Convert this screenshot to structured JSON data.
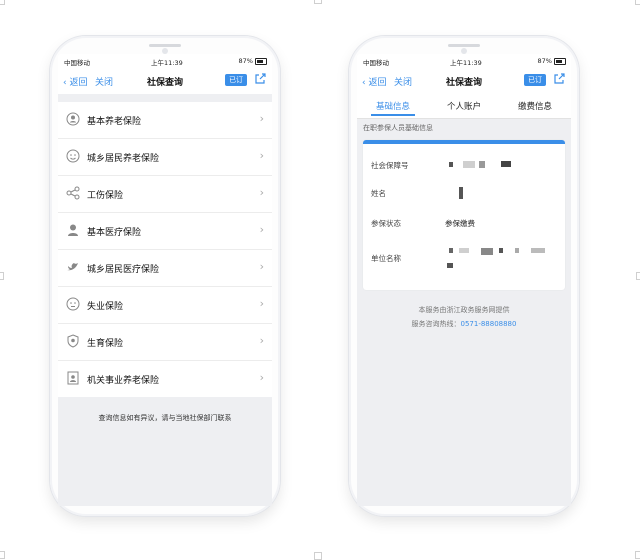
{
  "status_bar": {
    "carrier": "中国移动",
    "time": "上午11:39",
    "battery": "87%"
  },
  "nav": {
    "back": "返回",
    "close": "关闭",
    "title": "社保查询",
    "subscribe": "已订"
  },
  "insurance_list": {
    "items": [
      {
        "label": "基本养老保险",
        "icon": "person-badge-icon"
      },
      {
        "label": "城乡居民养老保险",
        "icon": "elder-face-icon"
      },
      {
        "label": "工伤保险",
        "icon": "share-nodes-icon"
      },
      {
        "label": "基本医疗保险",
        "icon": "doctor-icon"
      },
      {
        "label": "城乡居民医疗保险",
        "icon": "bird-icon"
      },
      {
        "label": "失业保险",
        "icon": "face-icon"
      },
      {
        "label": "生育保险",
        "icon": "shield-baby-icon"
      },
      {
        "label": "机关事业养老保险",
        "icon": "document-person-icon"
      }
    ],
    "note": "查询信息如有异议，请与当地社保部门联系"
  },
  "detail": {
    "tabs": [
      "基础信息",
      "个人账户",
      "缴费信息"
    ],
    "section_title": "在职参保人员基础信息",
    "rows": [
      {
        "label": "社会保障号"
      },
      {
        "label": "姓名"
      },
      {
        "label": "参保状态",
        "value": "参保缴费"
      },
      {
        "label": "单位名称"
      }
    ],
    "footer_provider": "本服务由浙江政务服务网提供",
    "hotline_label": "服务咨询热线：",
    "hotline_number": "0571-88808880"
  },
  "colors": {
    "accent": "#3a8ee8",
    "background": "#eeeff2"
  }
}
